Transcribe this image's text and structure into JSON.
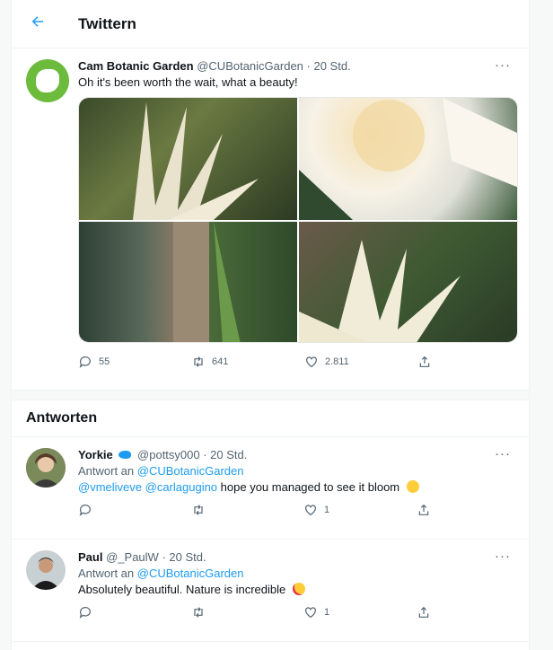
{
  "header": {
    "title": "Twittern"
  },
  "tweet": {
    "name": "Cam Botanic Garden",
    "handle": "@CUBotanicGarden",
    "time": "· 20 Std.",
    "text": "Oh it's been worth the wait, what a beauty!",
    "replies": "55",
    "retweets": "641",
    "likes": "2.811"
  },
  "replies_section": {
    "title": "Antworten"
  },
  "replies": [
    {
      "name": "Yorkie",
      "handle": "@pottsy000",
      "time": "· 20 Std.",
      "reply_to_label": "Antwort an",
      "reply_to_handle": "@CUBotanicGarden",
      "mention1": "@vmeliveve",
      "mention2": "@carlagugino",
      "text": "hope you managed to see it bloom",
      "likes": "1"
    },
    {
      "name": "Paul",
      "handle": "@_PaulW",
      "time": "· 20 Std.",
      "reply_to_label": "Antwort an",
      "reply_to_handle": "@CUBotanicGarden",
      "text": "Absolutely beautiful. Nature is incredible",
      "likes": "1"
    }
  ]
}
